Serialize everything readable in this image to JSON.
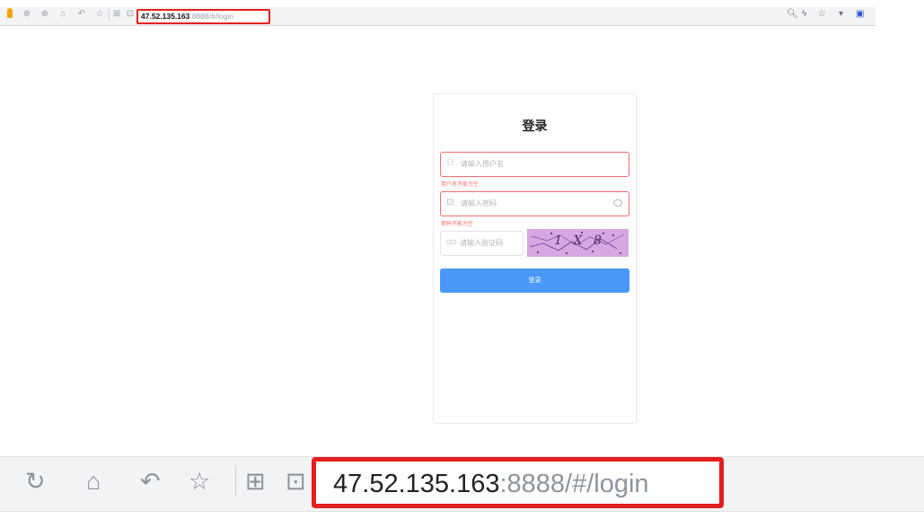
{
  "browser": {
    "url_host": "47.52.135.163",
    "url_rest": ":8888/#/login",
    "toolbar_icons": [
      "back-arrow",
      "forward-arrow",
      "home",
      "refresh",
      "favorites",
      "shield",
      "lock"
    ],
    "toolbar_right_icons": [
      "search",
      "lightning",
      "star",
      "dropdown",
      "extension"
    ]
  },
  "login": {
    "title": "登录",
    "username_placeholder": "请输入用户名",
    "username_error": "用户名不能为空",
    "password_placeholder": "请输入密码",
    "password_error": "密码不能为空",
    "captcha_placeholder": "请输入验证码",
    "captcha_text": "1 X 8",
    "submit_label": "登录"
  },
  "zoom": {
    "url_host": "47.52.135.163",
    "url_rest": ":8888/#/login",
    "icons": [
      "refresh",
      "home",
      "undo",
      "favorites",
      "shield",
      "lock"
    ]
  }
}
